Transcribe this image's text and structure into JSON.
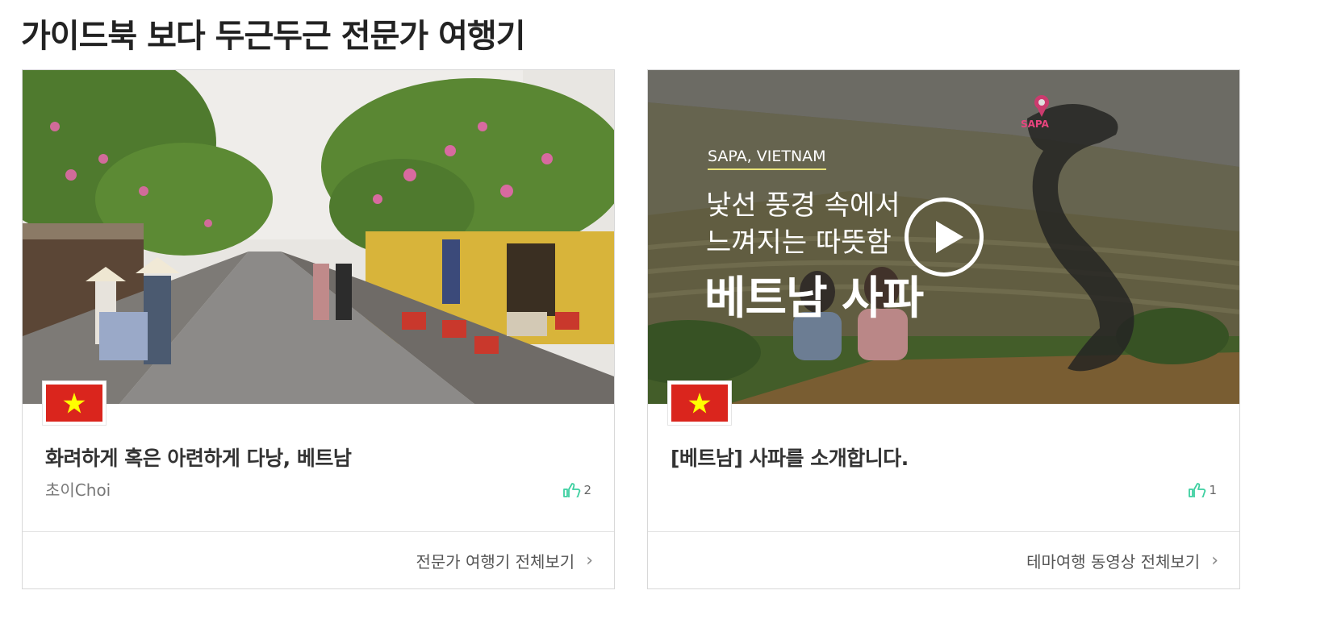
{
  "section": {
    "title": "가이드북 보다 두근두근 전문가 여행기"
  },
  "cards": [
    {
      "title": "화려하게 혹은 아련하게 다낭, 베트남",
      "author": "초이Choi",
      "likes": "2",
      "footer_link": "전문가 여행기 전체보기",
      "flag": "vietnam-flag"
    },
    {
      "title": "[베트남] 사파를 소개합니다.",
      "author": "",
      "likes": "1",
      "footer_link": "테마여행 동영상 전체보기",
      "flag": "vietnam-flag",
      "video": {
        "location": "SAPA, VIETNAM",
        "line1": "낯선 풍경 속에서",
        "line2": "느껴지는 따뜻함",
        "headline": "베트남 사파",
        "map_pin_label": "SAPA"
      }
    }
  ],
  "colors": {
    "flag_red": "#da251d",
    "flag_star": "#ffff00",
    "like_icon": "#3dcfa0",
    "overlay_accent": "#e9e47a",
    "pin": "#e8447e"
  },
  "icons": {
    "like": "thumbs-up-icon",
    "chevron": "chevron-right-icon",
    "play": "play-icon"
  }
}
